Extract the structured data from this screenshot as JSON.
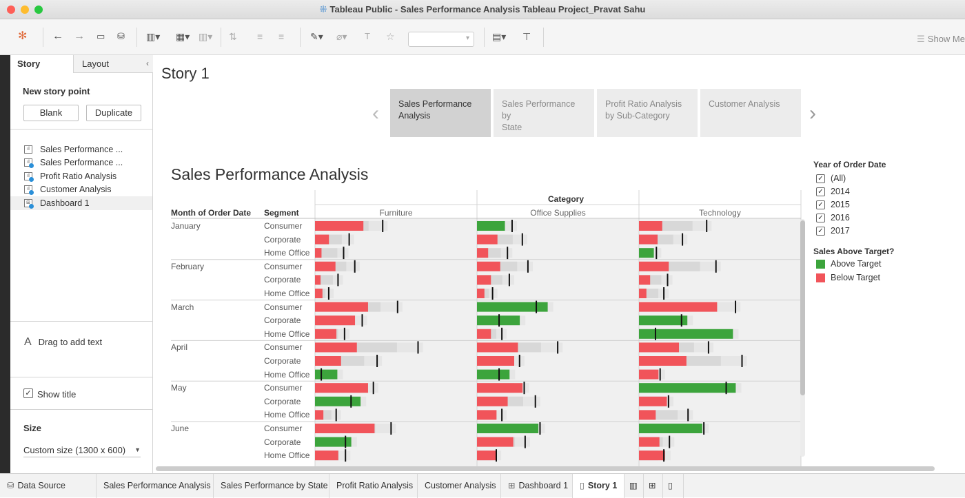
{
  "window": {
    "title": "Tableau Public - Sales Performance Analysis Tableau Project_Pravat Sahu"
  },
  "toolbar": {
    "show_me": "Show Me"
  },
  "story_pane": {
    "tabs": [
      "Story",
      "Layout"
    ],
    "new_story_point": "New story point",
    "blank": "Blank",
    "duplicate": "Duplicate",
    "sheets": [
      "Sales Performance ...",
      "Sales Performance ...",
      "Profit Ratio Analysis",
      "Customer Analysis",
      "Dashboard 1"
    ],
    "drag_text": "Drag to add text",
    "show_title": "Show title",
    "size_label": "Size",
    "size_value": "Custom size (1300 x 600)"
  },
  "story": {
    "title": "Story 1",
    "points": [
      {
        "line1": "Sales Performance",
        "line2": "Analysis"
      },
      {
        "line1": "Sales Performance by",
        "line2": "State"
      },
      {
        "line1": "Profit Ratio Analysis",
        "line2": "by Sub-Category"
      },
      {
        "line1": "Customer Analysis",
        "line2": ""
      }
    ]
  },
  "dashboard": {
    "title": "Sales Performance Analysis"
  },
  "legend": {
    "year_title": "Year of Order Date",
    "years": [
      "(All)",
      "2014",
      "2015",
      "2016",
      "2017"
    ],
    "sales_title": "Sales Above Target?",
    "items": [
      {
        "label": "Above Target",
        "color": "#3ca43c"
      },
      {
        "label": "Below Target",
        "color": "#f1545a"
      }
    ]
  },
  "chart_data": {
    "type": "bar",
    "title": "Sales Performance Analysis",
    "header_category": "Category",
    "row_headers": [
      "Month of Order Date",
      "Segment"
    ],
    "categories": [
      "Furniture",
      "Office Supplies",
      "Technology"
    ],
    "segments": [
      "Consumer",
      "Corporate",
      "Home Office"
    ],
    "colors": {
      "above": "#3ca43c",
      "below": "#f1545a"
    },
    "xlim": [
      0,
      100
    ],
    "rows": [
      {
        "month": "January",
        "segment": "Consumer",
        "values": [
          {
            "sales": 52,
            "target": 72,
            "above": false
          },
          {
            "sales": 30,
            "target": 37,
            "above": true
          },
          {
            "sales": 25,
            "target": 72,
            "above": false
          }
        ]
      },
      {
        "month": "",
        "segment": "Corporate",
        "values": [
          {
            "sales": 15,
            "target": 36,
            "above": false
          },
          {
            "sales": 22,
            "target": 48,
            "above": false
          },
          {
            "sales": 20,
            "target": 46,
            "above": false
          }
        ]
      },
      {
        "month": "",
        "segment": "Home Office",
        "values": [
          {
            "sales": 7,
            "target": 30,
            "above": false
          },
          {
            "sales": 12,
            "target": 32,
            "above": false
          },
          {
            "sales": 16,
            "target": 18,
            "above": true
          }
        ]
      },
      {
        "month": "February",
        "segment": "Consumer",
        "values": [
          {
            "sales": 22,
            "target": 42,
            "above": false
          },
          {
            "sales": 25,
            "target": 54,
            "above": false
          },
          {
            "sales": 32,
            "target": 82,
            "above": false
          }
        ]
      },
      {
        "month": "",
        "segment": "Corporate",
        "values": [
          {
            "sales": 6,
            "target": 24,
            "above": false
          },
          {
            "sales": 15,
            "target": 34,
            "above": false
          },
          {
            "sales": 12,
            "target": 30,
            "above": false
          }
        ]
      },
      {
        "month": "",
        "segment": "Home Office",
        "values": [
          {
            "sales": 8,
            "target": 14,
            "above": false
          },
          {
            "sales": 8,
            "target": 16,
            "above": false
          },
          {
            "sales": 8,
            "target": 26,
            "above": false
          }
        ]
      },
      {
        "month": "March",
        "segment": "Consumer",
        "values": [
          {
            "sales": 57,
            "target": 88,
            "above": false
          },
          {
            "sales": 76,
            "target": 63,
            "above": true
          },
          {
            "sales": 84,
            "target": 103,
            "above": false
          }
        ]
      },
      {
        "month": "",
        "segment": "Corporate",
        "values": [
          {
            "sales": 43,
            "target": 50,
            "above": false
          },
          {
            "sales": 46,
            "target": 23,
            "above": true
          },
          {
            "sales": 52,
            "target": 45,
            "above": true
          }
        ]
      },
      {
        "month": "",
        "segment": "Home Office",
        "values": [
          {
            "sales": 23,
            "target": 31,
            "above": false
          },
          {
            "sales": 15,
            "target": 26,
            "above": false
          },
          {
            "sales": 101,
            "target": 17,
            "above": true
          }
        ]
      },
      {
        "month": "April",
        "segment": "Consumer",
        "values": [
          {
            "sales": 45,
            "target": 110,
            "above": false
          },
          {
            "sales": 44,
            "target": 86,
            "above": false
          },
          {
            "sales": 43,
            "target": 74,
            "above": false
          }
        ]
      },
      {
        "month": "",
        "segment": "Corporate",
        "values": [
          {
            "sales": 28,
            "target": 66,
            "above": false
          },
          {
            "sales": 40,
            "target": 45,
            "above": false
          },
          {
            "sales": 51,
            "target": 110,
            "above": false
          }
        ]
      },
      {
        "month": "",
        "segment": "Home Office",
        "values": [
          {
            "sales": 24,
            "target": 6,
            "above": true
          },
          {
            "sales": 35,
            "target": 23,
            "above": true
          },
          {
            "sales": 21,
            "target": 22,
            "above": false
          }
        ]
      },
      {
        "month": "May",
        "segment": "Consumer",
        "values": [
          {
            "sales": 57,
            "target": 62,
            "above": false
          },
          {
            "sales": 49,
            "target": 50,
            "above": false
          },
          {
            "sales": 104,
            "target": 93,
            "above": true
          }
        ]
      },
      {
        "month": "",
        "segment": "Corporate",
        "values": [
          {
            "sales": 49,
            "target": 38,
            "above": true
          },
          {
            "sales": 33,
            "target": 62,
            "above": false
          },
          {
            "sales": 30,
            "target": 31,
            "above": false
          }
        ]
      },
      {
        "month": "",
        "segment": "Home Office",
        "values": [
          {
            "sales": 9,
            "target": 22,
            "above": false
          },
          {
            "sales": 21,
            "target": 26,
            "above": false
          },
          {
            "sales": 18,
            "target": 52,
            "above": false
          }
        ]
      },
      {
        "month": "June",
        "segment": "Consumer",
        "values": [
          {
            "sales": 64,
            "target": 81,
            "above": false
          },
          {
            "sales": 66,
            "target": 67,
            "above": true
          },
          {
            "sales": 68,
            "target": 69,
            "above": true
          }
        ]
      },
      {
        "month": "",
        "segment": "Corporate",
        "values": [
          {
            "sales": 39,
            "target": 32,
            "above": true
          },
          {
            "sales": 39,
            "target": 51,
            "above": false
          },
          {
            "sales": 22,
            "target": 32,
            "above": false
          }
        ]
      },
      {
        "month": "",
        "segment": "Home Office",
        "values": [
          {
            "sales": 25,
            "target": 32,
            "above": false
          },
          {
            "sales": 20,
            "target": 20,
            "above": false
          },
          {
            "sales": 28,
            "target": 26,
            "above": false
          }
        ]
      }
    ]
  },
  "bottom_tabs": [
    "Data Source",
    "Sales Performance Analysis",
    "Sales Performance by State",
    "Profit Ratio Analysis",
    "Customer Analysis",
    "Dashboard 1",
    "Story 1"
  ]
}
